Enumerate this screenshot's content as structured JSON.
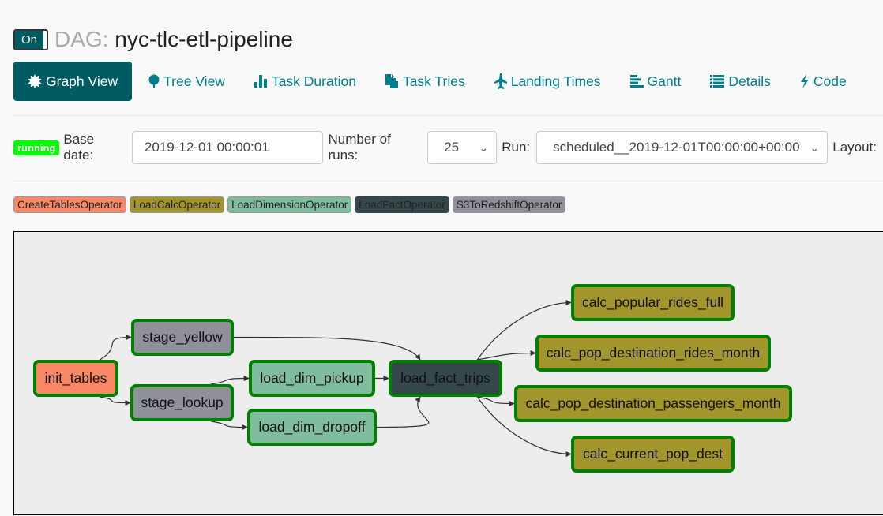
{
  "header": {
    "toggle_label": "On",
    "dag_prefix": "DAG:",
    "dag_name": "nyc-tlc-etl-pipeline"
  },
  "nav": {
    "items": [
      {
        "label": "Graph View",
        "icon": "graph-icon",
        "active": true
      },
      {
        "label": "Tree View",
        "icon": "tree-icon"
      },
      {
        "label": "Task Duration",
        "icon": "bar-chart-icon"
      },
      {
        "label": "Task Tries",
        "icon": "files-icon"
      },
      {
        "label": "Landing Times",
        "icon": "plane-icon"
      },
      {
        "label": "Gantt",
        "icon": "gantt-icon"
      },
      {
        "label": "Details",
        "icon": "list-icon"
      },
      {
        "label": "Code",
        "icon": "bolt-icon"
      }
    ]
  },
  "controls": {
    "state": "running",
    "state_color": "#00ff00",
    "base_date_label": "Base date:",
    "base_date_value": "2019-12-01 00:00:01",
    "num_runs_label": "Number of runs:",
    "num_runs_value": "25",
    "run_label": "Run:",
    "run_value": "scheduled__2019-12-01T00:00:00+00:00",
    "layout_label": "Layout:"
  },
  "legend": [
    {
      "label": "CreateTablesOperator",
      "color": "#f98866"
    },
    {
      "label": "LoadCalcOperator",
      "color": "#a2952c"
    },
    {
      "label": "LoadDimensionOperator",
      "color": "#80bd9e"
    },
    {
      "label": "LoadFactOperator",
      "color": "#36474c"
    },
    {
      "label": "S3ToRedshiftOperator",
      "color": "#8f909a"
    }
  ],
  "graph": {
    "status_border_color": "#008000",
    "nodes": [
      {
        "id": "init_tables",
        "operator": "CreateTablesOperator"
      },
      {
        "id": "stage_yellow",
        "operator": "S3ToRedshiftOperator"
      },
      {
        "id": "stage_lookup",
        "operator": "S3ToRedshiftOperator"
      },
      {
        "id": "load_dim_pickup",
        "operator": "LoadDimensionOperator"
      },
      {
        "id": "load_dim_dropoff",
        "operator": "LoadDimensionOperator"
      },
      {
        "id": "load_fact_trips",
        "operator": "LoadFactOperator"
      },
      {
        "id": "calc_popular_rides_full",
        "operator": "LoadCalcOperator"
      },
      {
        "id": "calc_pop_destination_rides_month",
        "operator": "LoadCalcOperator"
      },
      {
        "id": "calc_pop_destination_passengers_month",
        "operator": "LoadCalcOperator"
      },
      {
        "id": "calc_current_pop_dest",
        "operator": "LoadCalcOperator"
      }
    ],
    "edges": [
      [
        "init_tables",
        "stage_yellow"
      ],
      [
        "init_tables",
        "stage_lookup"
      ],
      [
        "stage_yellow",
        "load_fact_trips"
      ],
      [
        "stage_lookup",
        "load_dim_pickup"
      ],
      [
        "stage_lookup",
        "load_dim_dropoff"
      ],
      [
        "load_dim_pickup",
        "load_fact_trips"
      ],
      [
        "load_dim_dropoff",
        "load_fact_trips"
      ],
      [
        "load_fact_trips",
        "calc_popular_rides_full"
      ],
      [
        "load_fact_trips",
        "calc_pop_destination_rides_month"
      ],
      [
        "load_fact_trips",
        "calc_pop_destination_passengers_month"
      ],
      [
        "load_fact_trips",
        "calc_current_pop_dest"
      ]
    ]
  }
}
